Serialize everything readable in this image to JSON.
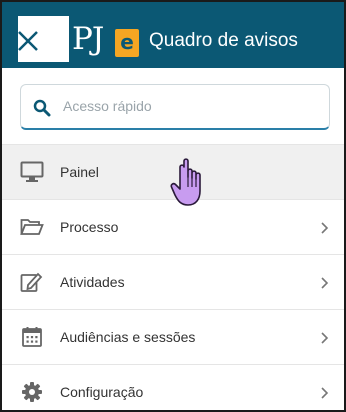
{
  "header": {
    "logo_pj": "PJ",
    "logo_e": "e",
    "title": "Quadro de avisos"
  },
  "search": {
    "placeholder": "Acesso rápido",
    "icon": "search-icon"
  },
  "menu": {
    "items": [
      {
        "label": "Painel",
        "icon": "monitor-icon",
        "active": true,
        "has_submenu": false
      },
      {
        "label": "Processo",
        "icon": "folder-icon",
        "active": false,
        "has_submenu": true
      },
      {
        "label": "Atividades",
        "icon": "edit-icon",
        "active": false,
        "has_submenu": true
      },
      {
        "label": "Audiências e sessões",
        "icon": "calendar-icon",
        "active": false,
        "has_submenu": true
      },
      {
        "label": "Configuração",
        "icon": "gear-icon",
        "active": false,
        "has_submenu": true
      }
    ]
  },
  "colors": {
    "header_bg": "#0b5874",
    "logo_e_bg": "#f5a623",
    "search_accent": "#2a7fa8",
    "cursor": "#c89cf0"
  }
}
